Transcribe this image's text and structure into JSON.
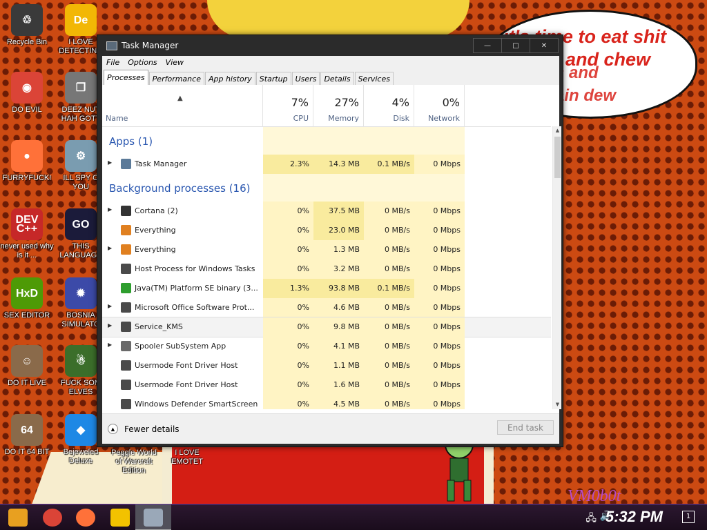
{
  "desktop": {
    "bubble_lines": [
      "it's time to eat shit",
      "and chew",
      "s and",
      "ain dew"
    ],
    "watermark": "VM0b0t",
    "icons": [
      {
        "label": "Recycle Bin",
        "color": "#3a3a3a",
        "glyph": "♲"
      },
      {
        "label": "I LOVE DETECTING",
        "color": "#f2b705",
        "glyph": "De"
      },
      {
        "label": "DO EVIL",
        "color": "#db4437",
        "glyph": "◉"
      },
      {
        "label": "DEEZ NUT HAH GOTT",
        "color": "#777777",
        "glyph": "❐"
      },
      {
        "label": "FURRYFUCK!",
        "color": "#ff7139",
        "glyph": "●"
      },
      {
        "label": "ILL SPY O YOU",
        "color": "#7a9cb0",
        "glyph": "⚙"
      },
      {
        "label": "never used why is it ...",
        "color": "#c62828",
        "glyph": "DEV C++"
      },
      {
        "label": "THIS LANGUAGE",
        "color": "#1b1b3a",
        "glyph": "GO"
      },
      {
        "label": "SEX EDITOR",
        "color": "#4e9a06",
        "glyph": "HxD"
      },
      {
        "label": "BOSNIA SIMULATO",
        "color": "#3c4aa8",
        "glyph": "✹"
      },
      {
        "label": "DO IT LIVE",
        "color": "#8a6a4a",
        "glyph": "☺"
      },
      {
        "label": "FUCK SOM ELVES",
        "color": "#3b6e2a",
        "glyph": "☃"
      },
      {
        "label": "DO IT 64 BIT",
        "color": "#8a6a4a",
        "glyph": "64"
      },
      {
        "label": "Bejeweled Deluxe",
        "color": "#1e88e5",
        "glyph": "◆"
      },
      {
        "label": "Peggle World of Warcraft Edition",
        "color": "transparent",
        "glyph": ""
      },
      {
        "label": "I LOVE EMOTET",
        "color": "transparent",
        "glyph": ""
      }
    ]
  },
  "window": {
    "title": "Task Manager",
    "controls": [
      "—",
      "□",
      "✕"
    ],
    "menu": [
      "File",
      "Options",
      "View"
    ],
    "tabs": [
      "Processes",
      "Performance",
      "App history",
      "Startup",
      "Users",
      "Details",
      "Services"
    ],
    "columns": {
      "name": "Name",
      "cpu": {
        "pct": "7%",
        "label": "CPU"
      },
      "memory": {
        "pct": "27%",
        "label": "Memory"
      },
      "disk": {
        "pct": "4%",
        "label": "Disk"
      },
      "network": {
        "pct": "0%",
        "label": "Network"
      }
    },
    "groups": {
      "apps": "Apps (1)",
      "background": "Background processes (16)"
    },
    "processes": [
      {
        "name": "Task Manager",
        "cpu": "2.3%",
        "mem": "14.3 MB",
        "disk": "0.1 MB/s",
        "net": "0 Mbps",
        "icon": "#5b7a99",
        "exp": true,
        "group": "apps"
      },
      {
        "name": "Cortana (2)",
        "cpu": "0%",
        "mem": "37.5 MB",
        "disk": "0 MB/s",
        "net": "0 Mbps",
        "icon": "#333333",
        "exp": true
      },
      {
        "name": "Everything",
        "cpu": "0%",
        "mem": "23.0 MB",
        "disk": "0 MB/s",
        "net": "0 Mbps",
        "icon": "#e08020",
        "exp": false
      },
      {
        "name": "Everything",
        "cpu": "0%",
        "mem": "1.3 MB",
        "disk": "0 MB/s",
        "net": "0 Mbps",
        "icon": "#e08020",
        "exp": true
      },
      {
        "name": "Host Process for Windows Tasks",
        "cpu": "0%",
        "mem": "3.2 MB",
        "disk": "0 MB/s",
        "net": "0 Mbps",
        "icon": "#4a4a4a",
        "exp": false
      },
      {
        "name": "Java(TM) Platform SE binary (3...",
        "cpu": "1.3%",
        "mem": "93.8 MB",
        "disk": "0.1 MB/s",
        "net": "0 Mbps",
        "icon": "#2e9e2e",
        "exp": false
      },
      {
        "name": "Microsoft Office Software Prot...",
        "cpu": "0%",
        "mem": "4.6 MB",
        "disk": "0 MB/s",
        "net": "0 Mbps",
        "icon": "#4a4a4a",
        "exp": true
      },
      {
        "name": "Service_KMS",
        "cpu": "0%",
        "mem": "9.8 MB",
        "disk": "0 MB/s",
        "net": "0 Mbps",
        "icon": "#4a4a4a",
        "exp": true,
        "selected": true
      },
      {
        "name": "Spooler SubSystem App",
        "cpu": "0%",
        "mem": "4.1 MB",
        "disk": "0 MB/s",
        "net": "0 Mbps",
        "icon": "#6a6a6a",
        "exp": true
      },
      {
        "name": "Usermode Font Driver Host",
        "cpu": "0%",
        "mem": "1.1 MB",
        "disk": "0 MB/s",
        "net": "0 Mbps",
        "icon": "#4a4a4a",
        "exp": false
      },
      {
        "name": "Usermode Font Driver Host",
        "cpu": "0%",
        "mem": "1.6 MB",
        "disk": "0 MB/s",
        "net": "0 Mbps",
        "icon": "#4a4a4a",
        "exp": false
      },
      {
        "name": "Windows Defender SmartScreen",
        "cpu": "0%",
        "mem": "4.5 MB",
        "disk": "0 MB/s",
        "net": "0 Mbps",
        "icon": "#4a4a4a",
        "exp": false
      }
    ],
    "footer": {
      "fewer_details": "Fewer details",
      "end_task": "End task"
    }
  },
  "taskbar": {
    "clock": "5:32 PM",
    "pins": [
      {
        "name": "start-icon",
        "color": "#e8a020"
      },
      {
        "name": "chrome-icon",
        "color": "#db4437"
      },
      {
        "name": "firefox-icon",
        "color": "#ff7139"
      },
      {
        "name": "explorer-icon",
        "color": "#f2c200"
      },
      {
        "name": "task-manager-icon",
        "color": "#9aa8b8"
      }
    ],
    "tray_icons": [
      "network-icon",
      "volume-icon"
    ],
    "notification_count": "1"
  }
}
